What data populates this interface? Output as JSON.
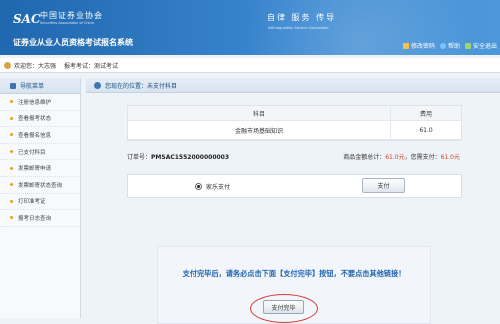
{
  "header": {
    "logo_mark": "SAC",
    "org_name_cn": "中国证券业协会",
    "org_name_en": "Securities Association of China",
    "site_title": "证券业从业人员资格考试报名系统",
    "motto_cn": "自律  服务  传导",
    "motto_en": "Self-regulation   Service   Conduction",
    "links": [
      {
        "label": "修改密码",
        "icon": "lock-icon"
      },
      {
        "label": "帮助",
        "icon": "help-icon"
      },
      {
        "label": "安全退出",
        "icon": "exit-icon"
      }
    ]
  },
  "infobar": {
    "welcome": "欢迎您：大志强",
    "exam": "报考考试：测试考试"
  },
  "sidebar": {
    "title": "导航菜单",
    "items": [
      {
        "label": "注册信息维护"
      },
      {
        "label": "查看报考状态"
      },
      {
        "label": "查看报名信息"
      },
      {
        "label": "已支付科目"
      },
      {
        "label": "发票邮寄申请"
      },
      {
        "label": "发票邮寄状态查询"
      },
      {
        "label": "打印准考证"
      },
      {
        "label": "报考日志查询"
      }
    ]
  },
  "breadcrumb": "您现在的位置：未支付科目",
  "order_table": {
    "headers": [
      "科目",
      "费用"
    ],
    "rows": [
      [
        "金融市场基础知识",
        "61.0"
      ]
    ]
  },
  "order": {
    "number_label": "订单号：",
    "number": "PMSAC1552000000003",
    "total_label": "商品金额总计：",
    "total": "61.0元",
    "pay_label": "，您需支付：",
    "pay": "61.0元"
  },
  "payment": {
    "method": "家乐支付",
    "button": "支付"
  },
  "notice": {
    "message": "支付完毕后，请务必点击下面【支付完毕】按钮，不要点击其他链接！",
    "button": "支付完毕"
  }
}
